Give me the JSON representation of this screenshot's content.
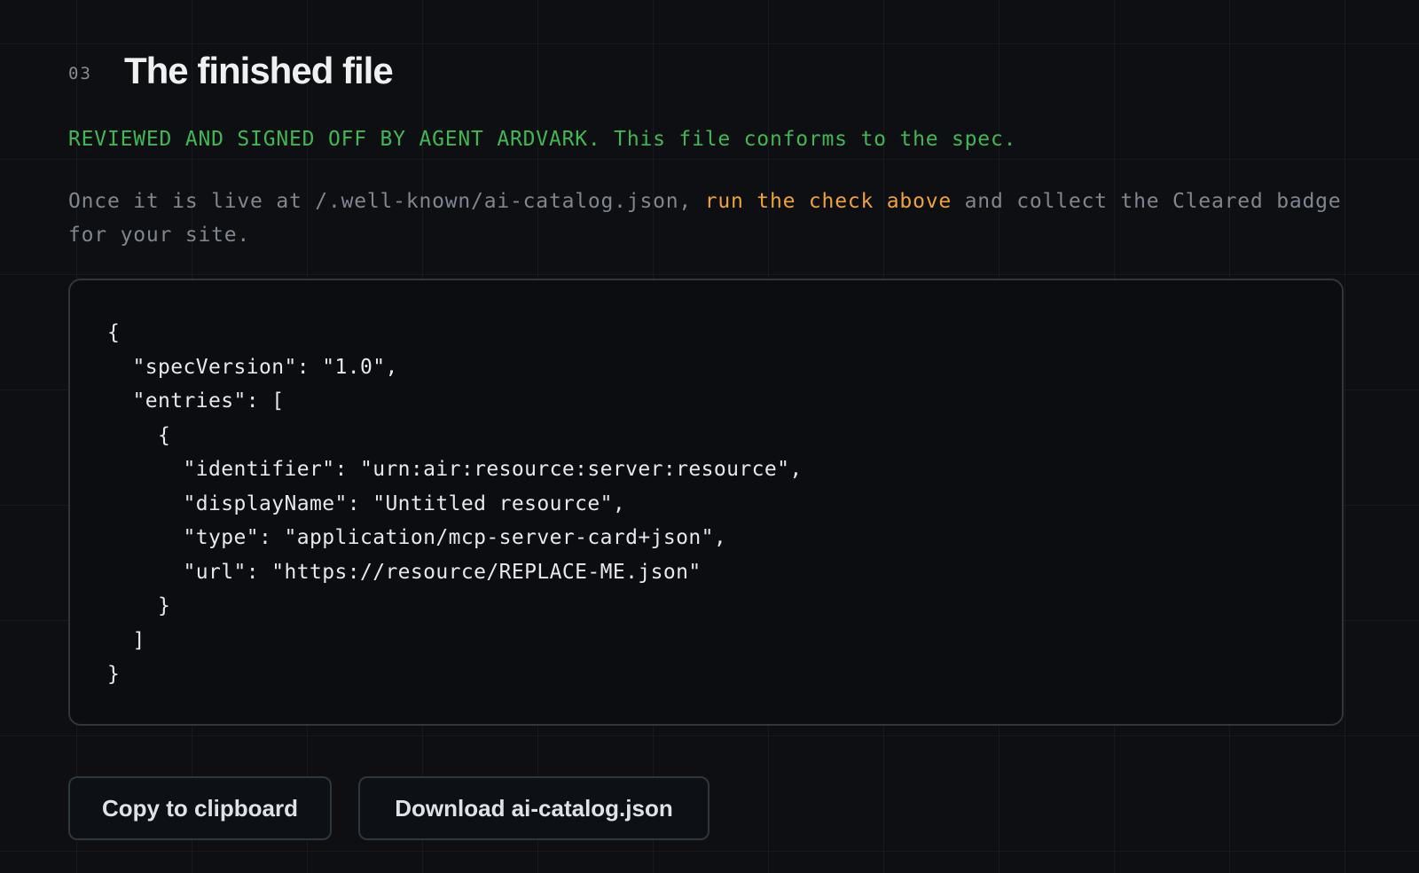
{
  "section": {
    "number": "03",
    "title": "The finished file"
  },
  "signoff": {
    "text": "REVIEWED AND SIGNED OFF BY AGENT ARDVARK. This file conforms to the spec.",
    "color": "#3fb854"
  },
  "instructions": {
    "before": "Once it is live at /.well-known/ai-catalog.json, ",
    "link": "run the check above",
    "after": " and collect the Cleared badge for your site.",
    "link_color": "#f0a23a"
  },
  "code": {
    "content": "{\n  \"specVersion\": \"1.0\",\n  \"entries\": [\n    {\n      \"identifier\": \"urn:air:resource:server:resource\",\n      \"displayName\": \"Untitled resource\",\n      \"type\": \"application/mcp-server-card+json\",\n      \"url\": \"https://resource/REPLACE-ME.json\"\n    }\n  ]\n}"
  },
  "actions": {
    "copy_label": "Copy to clipboard",
    "download_label": "Download ai-catalog.json"
  },
  "colors": {
    "background": "#0d0f12",
    "text": "#eef0f2",
    "muted": "#80868f",
    "border": "#30363d"
  }
}
